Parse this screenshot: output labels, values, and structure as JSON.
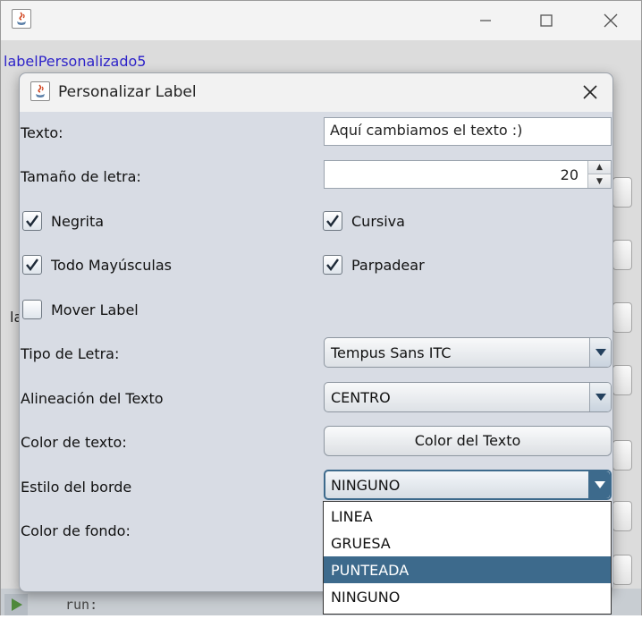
{
  "outer_window": {
    "label_personalizado": "labelPersonalizado5",
    "side_letters": "la",
    "console_text": "run:"
  },
  "dialog": {
    "title": "Personalizar Label",
    "texto_label": "Texto:",
    "texto_value": "Aquí cambiamos el texto :)",
    "tamano_label": "Tamaño de letra:",
    "tamano_value": "20",
    "negrita_label": "Negrita",
    "negrita_checked": true,
    "cursiva_label": "Cursiva",
    "cursiva_checked": true,
    "mayusculas_label": "Todo Mayúsculas",
    "mayusculas_checked": true,
    "parpadear_label": "Parpadear",
    "parpadear_checked": true,
    "mover_label": "Mover Label",
    "mover_checked": false,
    "tipo_letra_label": "Tipo de Letra:",
    "tipo_letra_value": "Tempus Sans ITC",
    "alineacion_label": "Alineación del Texto",
    "alineacion_value": "CENTRO",
    "color_texto_label": "Color de texto:",
    "color_texto_button": "Color del Texto",
    "estilo_borde_label": "Estilo del borde",
    "estilo_borde_value": "NINGUNO",
    "estilo_borde_options": [
      "LINEA",
      "GRUESA",
      "PUNTEADA",
      "NINGUNO"
    ],
    "estilo_borde_highlighted": "PUNTEADA",
    "color_fondo_label": "Color de fondo:"
  },
  "colors": {
    "selection": "#3d6a8c",
    "label_link": "#2e23c9",
    "dialog_bg": "#d8dce4"
  }
}
